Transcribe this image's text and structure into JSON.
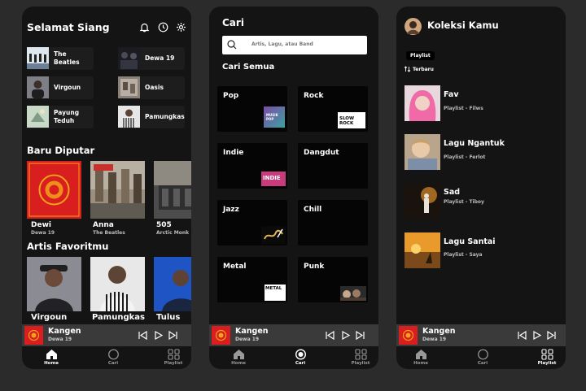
{
  "home": {
    "greeting": "Selamat Siang",
    "quick_picks": [
      {
        "label": "The Beatles"
      },
      {
        "label": "Dewa 19"
      },
      {
        "label": "Virgoun"
      },
      {
        "label": "Oasis"
      },
      {
        "label": "Payung Teduh"
      },
      {
        "label": "Pamungkas"
      }
    ],
    "recent_title": "Baru Diputar",
    "recent": [
      {
        "title": "Dewi",
        "artist": "Dewa 19"
      },
      {
        "title": "Anna",
        "artist": "The Beatles"
      },
      {
        "title": "505",
        "artist": "Arctic Monk"
      }
    ],
    "fav_title": "Artis Favoritmu",
    "artists": [
      "Virgoun",
      "Pamungkas",
      "Tulus"
    ]
  },
  "search": {
    "title": "Cari",
    "placeholder": "Artis, Lagu, atau Band",
    "browse_title": "Cari Semua",
    "genres": [
      {
        "label": "Pop"
      },
      {
        "label": "Rock"
      },
      {
        "label": "Indie"
      },
      {
        "label": "Dangdut"
      },
      {
        "label": "Jazz"
      },
      {
        "label": "Chill"
      },
      {
        "label": "Metal"
      },
      {
        "label": "Punk"
      }
    ],
    "genre_art_text": {
      "pop": "MUSIK POP",
      "rock": "SLOW ROCK",
      "indie": "INDIE",
      "metal": "METAL"
    }
  },
  "library": {
    "title": "Koleksi Kamu",
    "filter_chip": "Playlist",
    "sort_label": "Terbaru",
    "playlists": [
      {
        "name": "Fav",
        "sub": "Playlist - Filws"
      },
      {
        "name": "Lagu Ngantuk",
        "sub": "Playlist - Ferlot"
      },
      {
        "name": "Sad",
        "sub": "Playlist - Tiboy"
      },
      {
        "name": "Lagu Santai",
        "sub": "Playlist - Saya"
      }
    ]
  },
  "player": {
    "title": "Kangen",
    "artist": "Dewa 19"
  },
  "nav": {
    "home": "Home",
    "search": "Cari",
    "playlist": "Playlist"
  },
  "colors": {
    "background": "#141414",
    "page": "#2b2b2b",
    "player_bar": "#3a3a3a",
    "card": "#1d1d1d",
    "genre_card": "#050505",
    "album_red": "#d81e1e"
  }
}
